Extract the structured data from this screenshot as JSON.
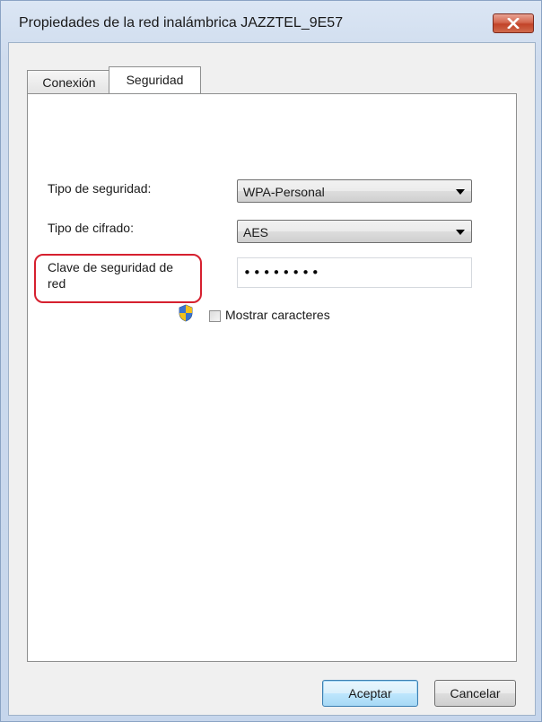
{
  "window": {
    "title": "Propiedades de la red inalámbrica JAZZTEL_9E57"
  },
  "tabs": [
    {
      "label": "Conexión",
      "active": false
    },
    {
      "label": "Seguridad",
      "active": true
    }
  ],
  "security": {
    "type_label": "Tipo de seguridad:",
    "type_value": "WPA-Personal",
    "cipher_label": "Tipo de cifrado:",
    "cipher_value": "AES",
    "key_label_line1": "Clave de seguridad de",
    "key_label_line2": "red",
    "key_value": "••••••••",
    "show_chars_label": "Mostrar caracteres",
    "show_chars_checked": false
  },
  "buttons": {
    "ok_label": "Aceptar",
    "cancel_label": "Cancelar"
  },
  "colors": {
    "highlight": "#d6202f",
    "close_button": "#c24328"
  },
  "icons": {
    "close": "close-icon",
    "uac_shield": "uac-shield-icon",
    "dropdown": "chevron-down-icon"
  }
}
